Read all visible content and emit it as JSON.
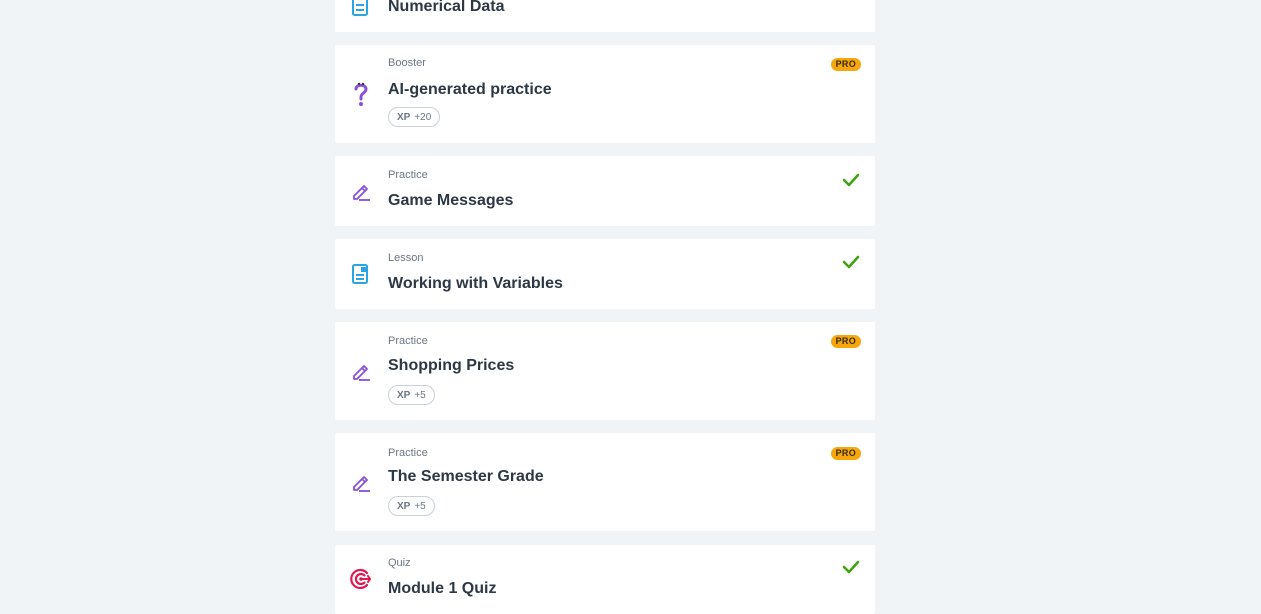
{
  "items": [
    {
      "type": "",
      "title": "Numerical Data",
      "icon": "lesson-icon"
    },
    {
      "type": "Booster",
      "title": "AI-generated practice",
      "icon": "question-icon",
      "pro": "PRO",
      "xp_label": "XP",
      "xp_value": "+20"
    },
    {
      "type": "Practice",
      "title": "Game Messages",
      "icon": "pencil-icon",
      "completed": true
    },
    {
      "type": "Lesson",
      "title": "Working with Variables",
      "icon": "lesson-icon",
      "completed": true
    },
    {
      "type": "Practice",
      "title": "Shopping Prices",
      "icon": "pencil-icon",
      "pro": "PRO",
      "xp_label": "XP",
      "xp_value": "+5"
    },
    {
      "type": "Practice",
      "title": "The Semester Grade",
      "icon": "pencil-icon",
      "pro": "PRO",
      "xp_label": "XP",
      "xp_value": "+5"
    },
    {
      "type": "Quiz",
      "title": "Module 1 Quiz",
      "icon": "target-icon",
      "completed": true
    }
  ],
  "colors": {
    "background": "#f1f4f7",
    "card": "#ffffff",
    "pro_badge": "#f5a70d",
    "check": "#3fa30f",
    "lesson_icon": "#2aa5e2",
    "practice_icon": "#8a4fd8",
    "quiz_icon": "#e0194f"
  }
}
